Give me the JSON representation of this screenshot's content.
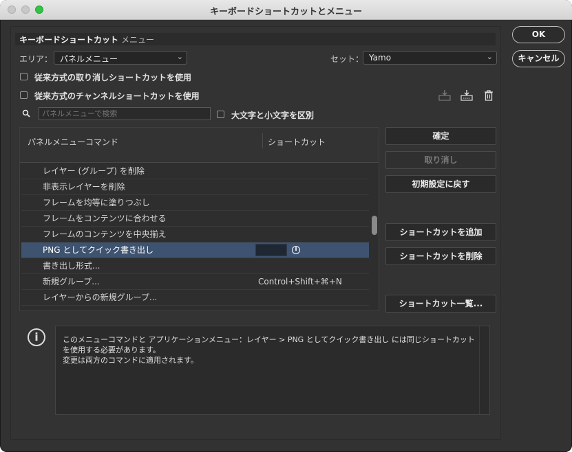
{
  "window": {
    "title": "キーボードショートカットとメニュー"
  },
  "tabs": [
    {
      "label": "キーボードショートカット"
    },
    {
      "label": "メニュー"
    }
  ],
  "area": {
    "label": "エリア：",
    "value": "パネルメニュー"
  },
  "set": {
    "label": "セット：",
    "value": "Yamo"
  },
  "options": {
    "legacy_undo": "従来方式の取り消しショートカットを使用",
    "legacy_channel": "従来方式のチャンネルショートカットを使用",
    "match_case": "大文字と小文字を区別"
  },
  "search": {
    "placeholder": "パネルメニューで検索"
  },
  "table": {
    "headers": {
      "command": "パネルメニューコマンド",
      "shortcut": "ショートカット"
    },
    "rows": [
      {
        "command": "レイヤー (グループ) を削除",
        "shortcut": ""
      },
      {
        "command": "非表示レイヤーを削除",
        "shortcut": ""
      },
      {
        "command": "フレームを均等に塗りつぶし",
        "shortcut": ""
      },
      {
        "command": "フレームをコンテンツに合わせる",
        "shortcut": ""
      },
      {
        "command": "フレームのコンテンツを中央揃え",
        "shortcut": ""
      },
      {
        "command": "PNG としてクイック書き出し",
        "shortcut": ""
      },
      {
        "command": "書き出し形式...",
        "shortcut": ""
      },
      {
        "command": "新規グループ...",
        "shortcut": "Control+Shift+⌘+N"
      },
      {
        "command": "レイヤーからの新規グループ...",
        "shortcut": ""
      }
    ],
    "selected_index": 5
  },
  "actions": {
    "accept": "確定",
    "undo": "取り消し",
    "defaults": "初期設定に戻す",
    "add": "ショートカットを追加",
    "delete": "ショートカットを削除",
    "summarize": "ショートカット一覧..."
  },
  "message": {
    "line1": "このメニューコマンドと アプリケーションメニュー：レイヤー > PNG としてクイック書き出し には同じショートカット",
    "line2": "を使用する必要があります。",
    "line3": "変更は両方のコマンドに適用されます。"
  },
  "buttons": {
    "ok": "OK",
    "cancel": "キャンセル"
  },
  "icons": {
    "save_set": "save-set-icon",
    "save_as_set": "save-as-set-icon",
    "delete_set": "trash-icon",
    "search": "search-icon",
    "info": "info-icon"
  },
  "colors": {
    "selected_row": "#3d5370",
    "window_bg": "#323232"
  }
}
